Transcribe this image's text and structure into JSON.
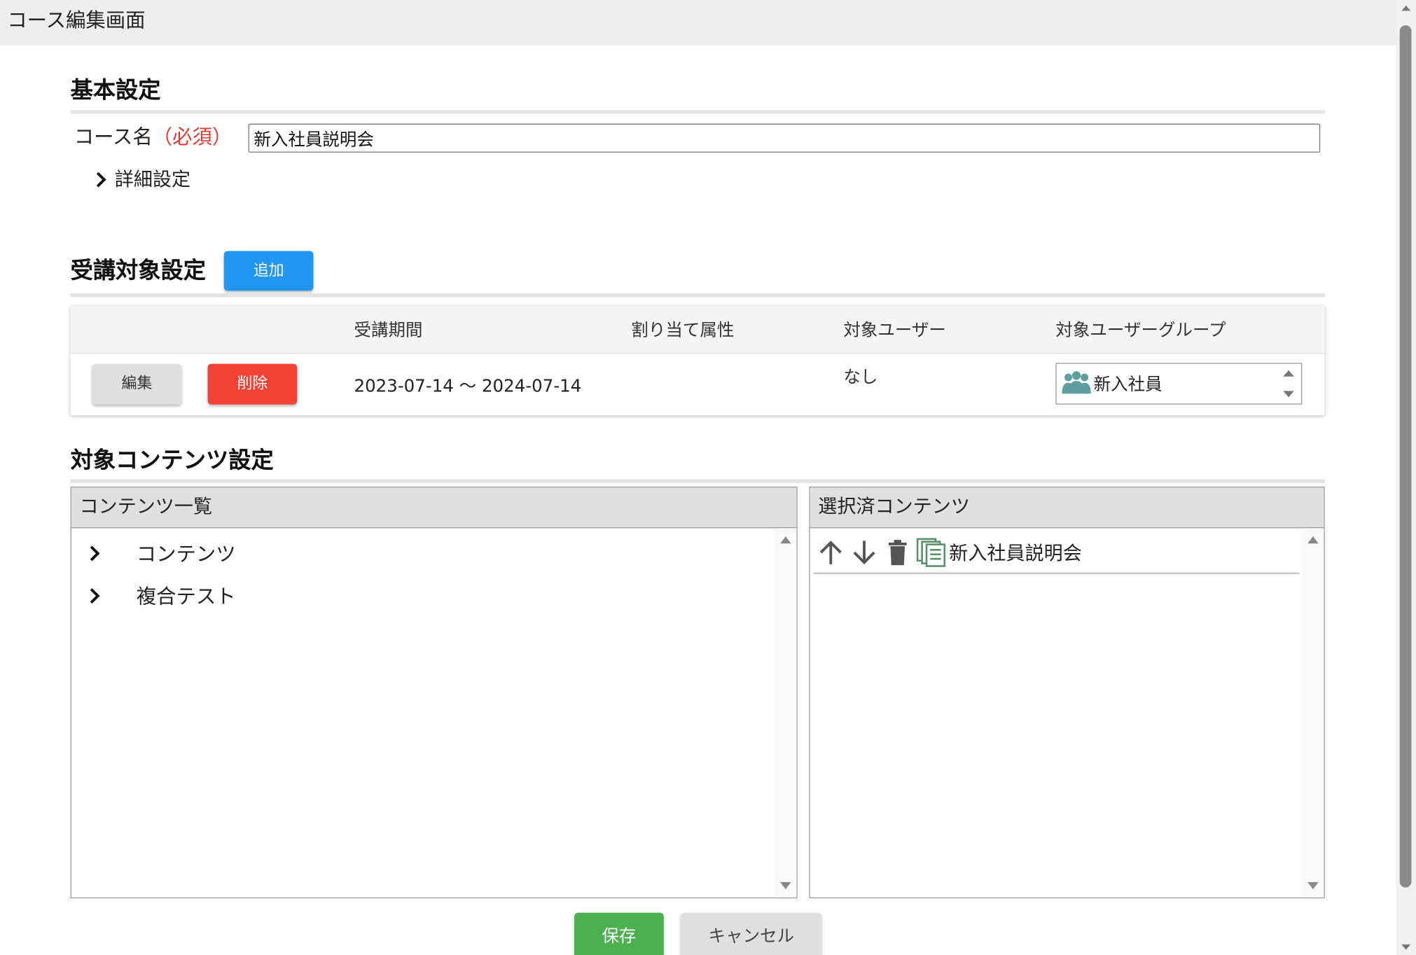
{
  "window": {
    "title": "コース編集画面"
  },
  "basic": {
    "section_title": "基本設定",
    "course_label": "コース名",
    "required_label": "（必須）",
    "course_name_value": "新入社員説明会",
    "detail_toggle_label": "詳細設定"
  },
  "target": {
    "section_title": "受講対象設定",
    "add_button": "追加",
    "columns": [
      "受講期間",
      "割り当て属性",
      "対象ユーザー",
      "対象ユーザーグループ"
    ],
    "rows": [
      {
        "edit_button": "編集",
        "delete_button": "削除",
        "period": "2023-07-14 ～ 2024-07-14",
        "attribute": "",
        "users": "なし",
        "groups": [
          "新入社員"
        ]
      }
    ]
  },
  "contents": {
    "section_title": "対象コンテンツ設定",
    "list_header": "コンテンツ一覧",
    "list_items": [
      "コンテンツ",
      "複合テスト"
    ],
    "selected_header": "選択済コンテンツ",
    "selected_items": [
      {
        "name": "新入社員説明会",
        "icons": [
          "arrow-up-icon",
          "arrow-down-icon",
          "trash-icon",
          "documents-icon"
        ]
      }
    ]
  },
  "footer": {
    "save_button": "保存",
    "cancel_button": "キャンセル"
  },
  "colors": {
    "primary": "#2196f3",
    "danger": "#f44336",
    "success": "#4caf50",
    "required": "#e53935",
    "group_icon": "#5f9ea0"
  }
}
